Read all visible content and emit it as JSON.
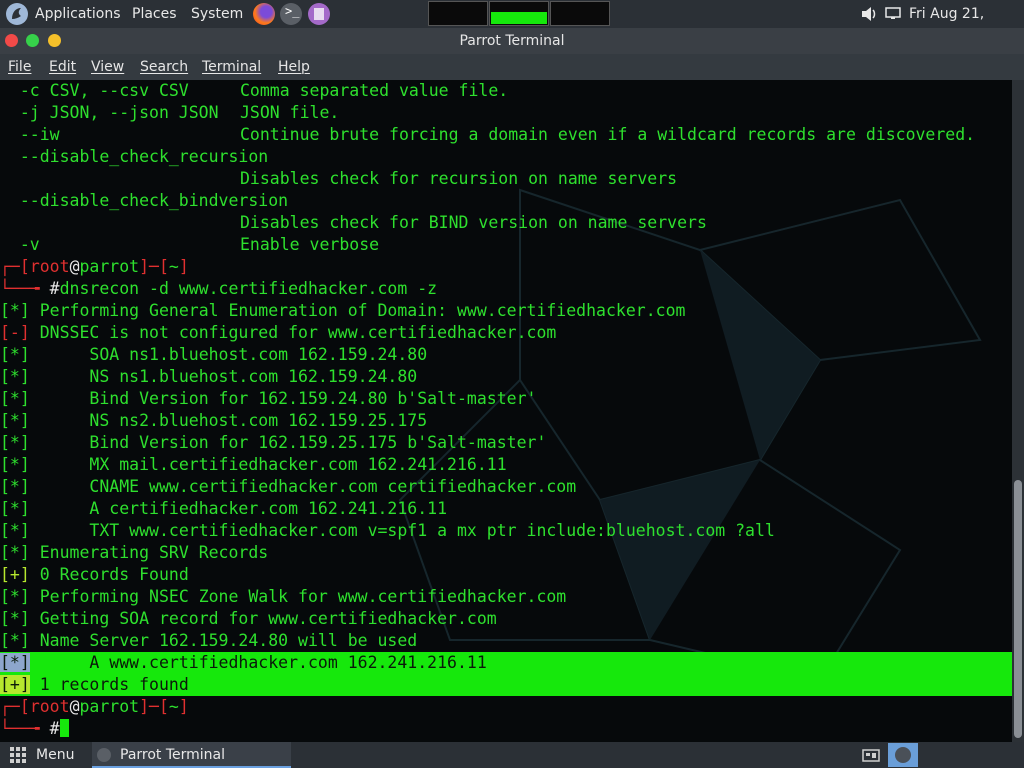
{
  "top_panel": {
    "applications": "Applications",
    "places": "Places",
    "system": "System",
    "clock": "Fri Aug 21, 02:29"
  },
  "window": {
    "title": "Parrot Terminal"
  },
  "menu": [
    "File",
    "Edit",
    "View",
    "Search",
    "Terminal",
    "Help"
  ],
  "terminal": {
    "help_lines": [
      {
        "opt": "  -c CSV, --csv CSV",
        "desc": "Comma separated value file."
      },
      {
        "opt": "  -j JSON, --json JSON",
        "desc": "JSON file."
      },
      {
        "opt": "  --iw",
        "desc": "Continue brute forcing a domain even if a wildcard records are discovered."
      },
      {
        "opt": "  --disable_check_recursion",
        "desc": ""
      },
      {
        "opt": "",
        "desc": "Disables check for recursion on name servers"
      },
      {
        "opt": "  --disable_check_bindversion",
        "desc": ""
      },
      {
        "opt": "",
        "desc": "Disables check for BIND version on name servers"
      },
      {
        "opt": "  -v",
        "desc": "Enable verbose"
      }
    ],
    "prompt": {
      "user": "root",
      "at": "@",
      "host": "parrot",
      "dir": "~",
      "hash": "#"
    },
    "command": "dnsrecon -d www.certifiedhacker.com -z",
    "output": [
      {
        "tag": "[*]",
        "text": " Performing General Enumeration of Domain: www.certifiedhacker.com"
      },
      {
        "tag": "[-]",
        "text": " DNSSEC is not configured for www.certifiedhacker.com"
      },
      {
        "tag": "[*]",
        "text": " \t SOA ns1.bluehost.com 162.159.24.80"
      },
      {
        "tag": "[*]",
        "text": " \t NS ns1.bluehost.com 162.159.24.80"
      },
      {
        "tag": "[*]",
        "text": " \t Bind Version for 162.159.24.80 b'Salt-master'"
      },
      {
        "tag": "[*]",
        "text": " \t NS ns2.bluehost.com 162.159.25.175"
      },
      {
        "tag": "[*]",
        "text": " \t Bind Version for 162.159.25.175 b'Salt-master'"
      },
      {
        "tag": "[*]",
        "text": " \t MX mail.certifiedhacker.com 162.241.216.11"
      },
      {
        "tag": "[*]",
        "text": " \t CNAME www.certifiedhacker.com certifiedhacker.com"
      },
      {
        "tag": "[*]",
        "text": " \t A certifiedhacker.com 162.241.216.11"
      },
      {
        "tag": "[*]",
        "text": " \t TXT www.certifiedhacker.com v=spf1 a mx ptr include:bluehost.com ?all"
      },
      {
        "tag": "[*]",
        "text": " Enumerating SRV Records"
      },
      {
        "tag": "[+]",
        "text": " 0 Records Found"
      },
      {
        "tag": "[*]",
        "text": " Performing NSEC Zone Walk for www.certifiedhacker.com"
      },
      {
        "tag": "[*]",
        "text": " Getting SOA record for www.certifiedhacker.com"
      },
      {
        "tag": "[*]",
        "text": " Name Server 162.159.24.80 will be used"
      },
      {
        "tag": "[*]",
        "text": " \t A www.certifiedhacker.com 162.241.216.11"
      },
      {
        "tag": "[+]",
        "text": " 1 records found"
      }
    ]
  },
  "bottom_panel": {
    "menu": "Menu",
    "task": "Parrot Terminal"
  },
  "colors": {
    "terminal_green": "#2ee02e",
    "error_red": "#e03030",
    "highlight": "#16e80c"
  }
}
